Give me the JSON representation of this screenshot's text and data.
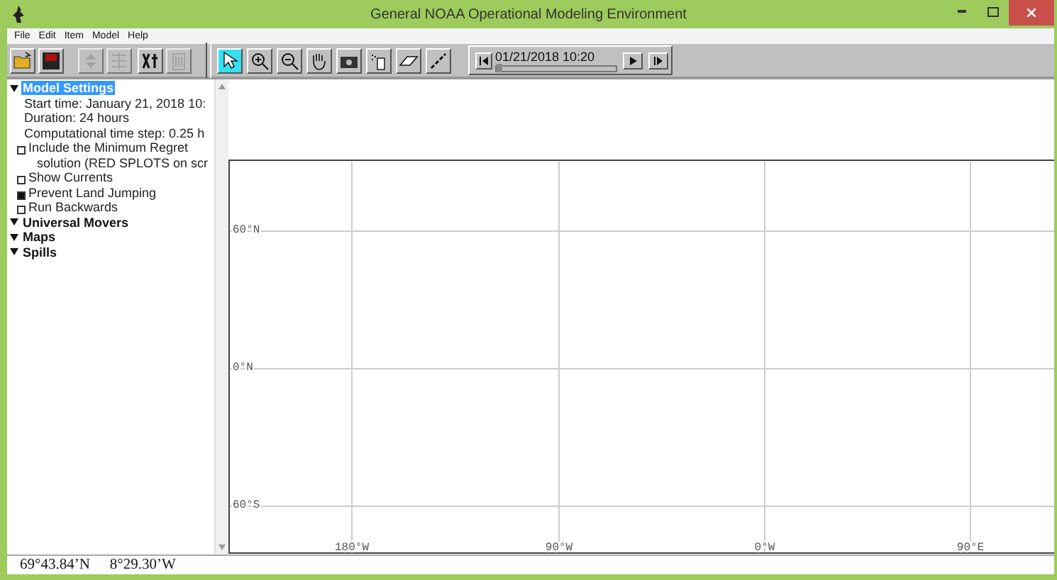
{
  "window": {
    "title": "General NOAA Operational Modeling Environment"
  },
  "menu": [
    "File",
    "Edit",
    "Item",
    "Model",
    "Help"
  ],
  "toolbar": {
    "buttons": [
      {
        "kind": "open",
        "disabled": false
      },
      {
        "kind": "save",
        "disabled": false
      },
      {
        "kind": "updown",
        "disabled": true
      },
      {
        "kind": "list",
        "disabled": true
      },
      {
        "kind": "tools",
        "disabled": false
      },
      {
        "kind": "trash",
        "disabled": true
      }
    ],
    "tools": [
      {
        "kind": "arrow",
        "selected": true
      },
      {
        "kind": "zoomin",
        "selected": false
      },
      {
        "kind": "zoomout",
        "selected": false
      },
      {
        "kind": "hand",
        "selected": false
      },
      {
        "kind": "camera",
        "selected": false
      },
      {
        "kind": "spray",
        "selected": false
      },
      {
        "kind": "eraser",
        "selected": false
      },
      {
        "kind": "dots",
        "selected": false
      }
    ],
    "time": "01/21/2018 10:20",
    "level": 0.0
  },
  "tree": [
    {
      "label": "Model Settings",
      "selected": true,
      "expanded": true,
      "children": [
        {
          "kind": "text",
          "lines": [
            "Start time: January 21, 2018 10:"
          ]
        },
        {
          "kind": "text",
          "lines": [
            "Duration: 24 hours"
          ]
        },
        {
          "kind": "text",
          "lines": [
            "Computational time step: 0.25 h"
          ]
        },
        {
          "kind": "checkbox",
          "checked": false,
          "lines": [
            "Include the Minimum Regret",
            "solution (RED SPLOTS on scr"
          ]
        },
        {
          "kind": "checkbox",
          "checked": false,
          "lines": [
            "Show Currents"
          ]
        },
        {
          "kind": "checkbox",
          "checked": true,
          "lines": [
            "Prevent Land Jumping"
          ]
        },
        {
          "kind": "checkbox",
          "checked": false,
          "lines": [
            "Run Backwards"
          ]
        }
      ]
    },
    {
      "label": "Universal Movers",
      "selected": false,
      "expanded": true
    },
    {
      "label": "Maps",
      "selected": false,
      "expanded": true
    },
    {
      "label": "Spills",
      "selected": false,
      "expanded": true
    }
  ],
  "map": {
    "latitude_labels": [
      "60°N",
      "0°N",
      "60°S"
    ],
    "longitude_labels": [
      "180°W",
      "90°W",
      "0°W",
      "90°E"
    ]
  },
  "status_bar": {
    "latitude": "69°43.84’N",
    "longitude": "8°29.30’W"
  }
}
